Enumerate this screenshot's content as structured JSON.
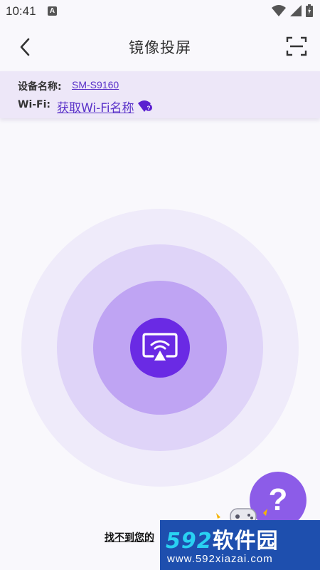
{
  "status_bar": {
    "time": "10:41",
    "notification_letter": "A"
  },
  "header": {
    "title": "镜像投屏"
  },
  "info": {
    "device_label": "设备名称:",
    "device_value": "SM-S9160",
    "wifi_label": "Wi-Fi:",
    "wifi_link": "获取Wi-Fi名称"
  },
  "help_fab": {
    "label": "?"
  },
  "footer": {
    "not_found_text": "找不到您的"
  },
  "watermark": {
    "logo_num": "592",
    "logo_text": "软件园",
    "url": "www.592xiazai.com"
  },
  "colors": {
    "accent": "#6A2AE4",
    "link": "#5B33C9",
    "info_bg": "#EDE7F8",
    "ring_outer": "#EFEBFA",
    "ring_middle": "#DFD4F8",
    "ring_inner": "#BFA4F3",
    "fab": "#8C5CE8"
  },
  "icons": [
    "back-arrow-icon",
    "scan-icon",
    "wifi-question-icon",
    "screen-cast-icon",
    "wifi-icon",
    "signal-icon",
    "battery-icon"
  ]
}
